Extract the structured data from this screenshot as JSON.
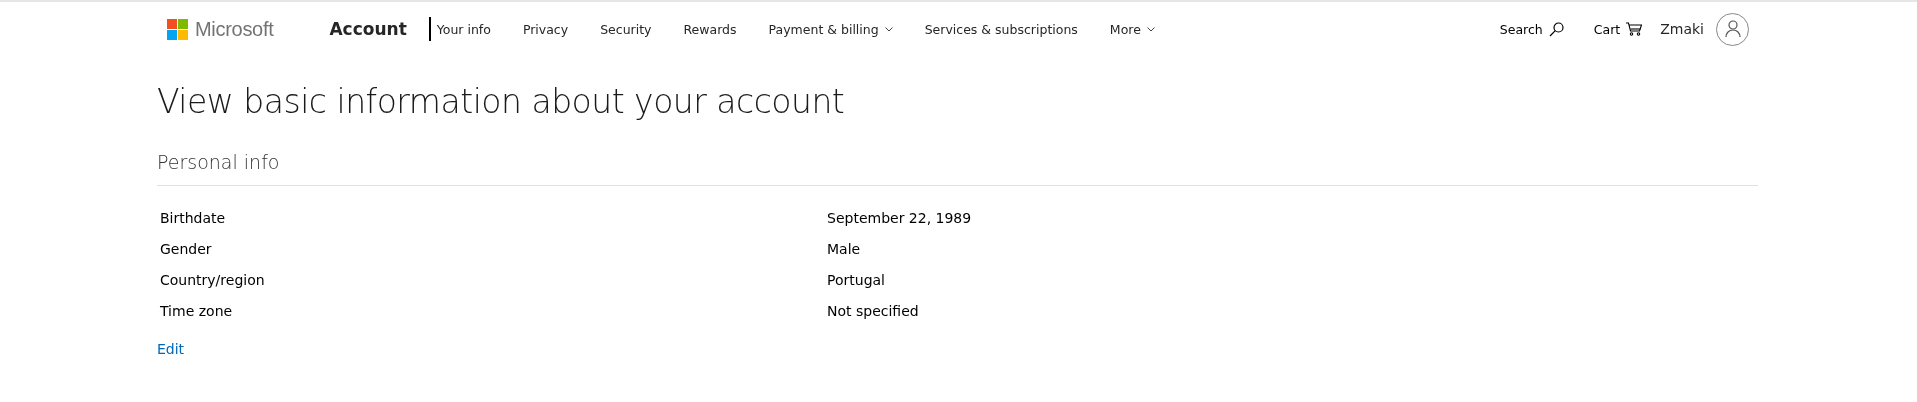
{
  "header": {
    "brand": "Microsoft",
    "section": "Account",
    "nav": [
      {
        "label": "Your info",
        "selected": true,
        "dropdown": false
      },
      {
        "label": "Privacy",
        "selected": false,
        "dropdown": false
      },
      {
        "label": "Security",
        "selected": false,
        "dropdown": false
      },
      {
        "label": "Rewards",
        "selected": false,
        "dropdown": false
      },
      {
        "label": "Payment & billing",
        "selected": false,
        "dropdown": true
      },
      {
        "label": "Services & subscriptions",
        "selected": false,
        "dropdown": false
      },
      {
        "label": "More",
        "selected": false,
        "dropdown": true
      }
    ],
    "search": "Search",
    "cart": "Cart",
    "user": "Zmaki"
  },
  "title": "View basic information about your account",
  "section": {
    "heading": "Personal info",
    "rows": [
      {
        "label": "Birthdate",
        "value": "September 22, 1989"
      },
      {
        "label": "Gender",
        "value": "Male"
      },
      {
        "label": "Country/region",
        "value": "Portugal"
      },
      {
        "label": "Time zone",
        "value": "Not specified"
      }
    ],
    "edit": "Edit"
  }
}
